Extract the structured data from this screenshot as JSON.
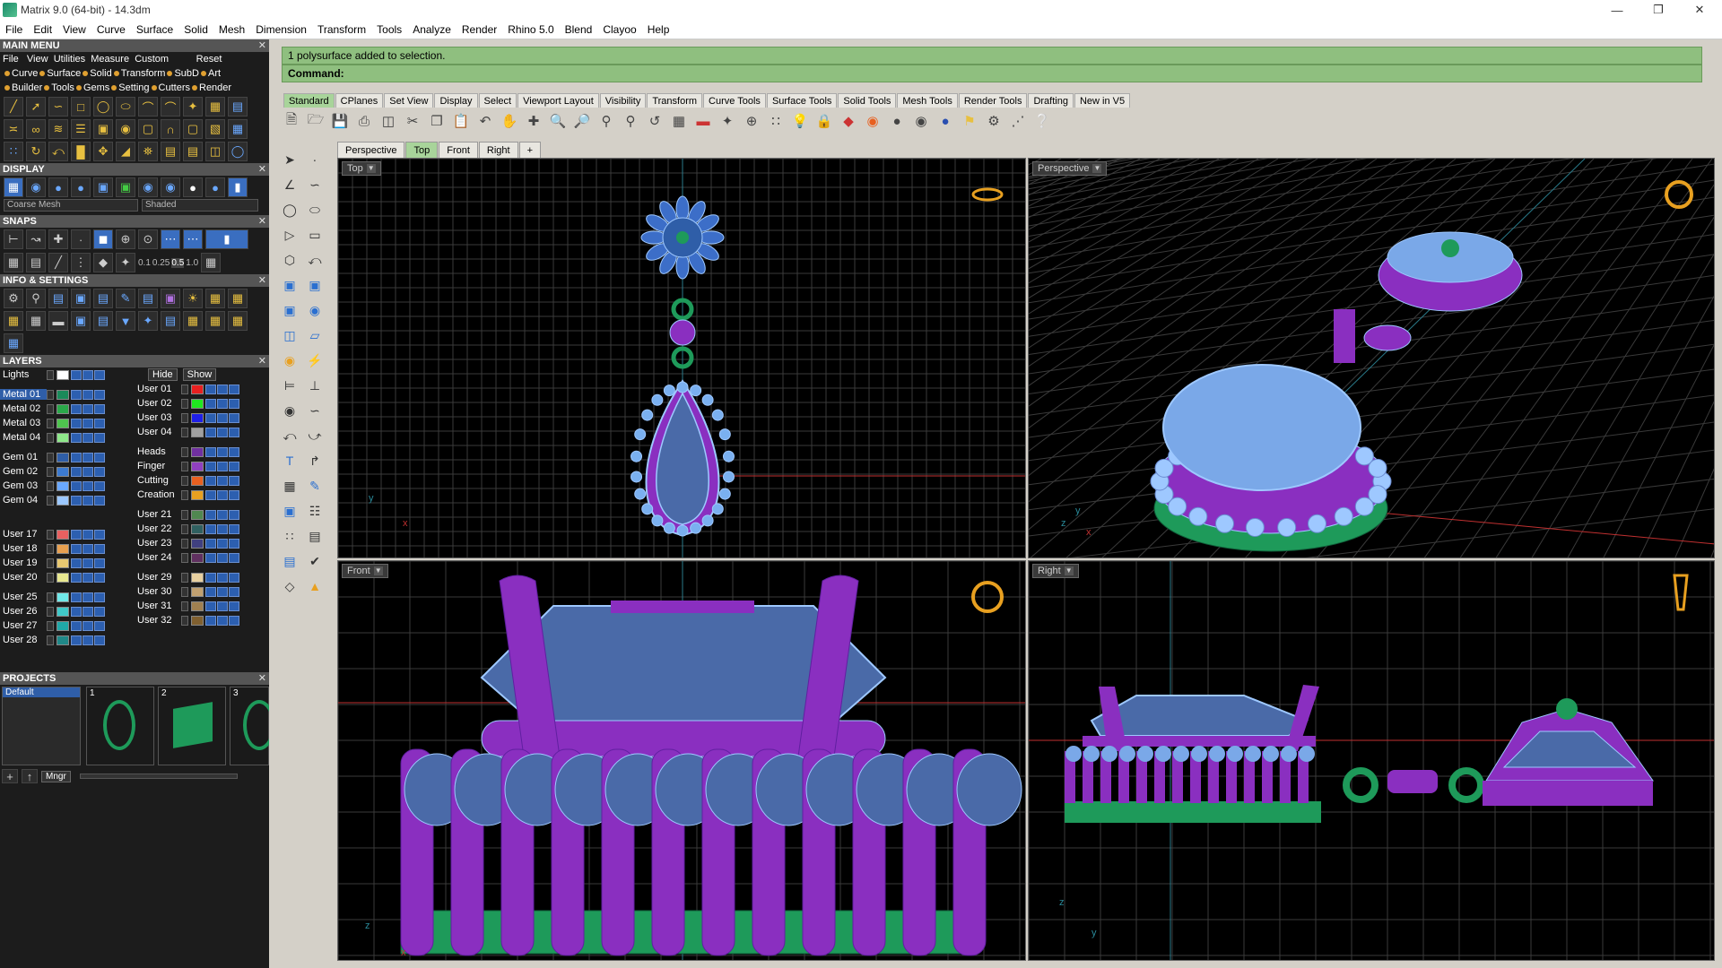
{
  "window": {
    "title": "Matrix 9.0 (64-bit) - 14.3dm",
    "minimize_icon": "minimize-icon",
    "maximize_icon": "maximize-icon",
    "close_icon": "close-icon"
  },
  "menubar": [
    "File",
    "Edit",
    "View",
    "Curve",
    "Surface",
    "Solid",
    "Mesh",
    "Dimension",
    "Transform",
    "Tools",
    "Analyze",
    "Render",
    "Rhino 5.0",
    "Blend",
    "Clayoo",
    "Help"
  ],
  "main_menu": {
    "title": "MAIN MENU",
    "reset": "Reset",
    "row1": [
      "File",
      "View",
      "Utilities",
      "Measure",
      "Custom"
    ],
    "row2": [
      "Curve",
      "Surface",
      "Solid",
      "Transform",
      "SubD",
      "Art"
    ],
    "row3": [
      "Builder",
      "Tools",
      "Gems",
      "Setting",
      "Cutters",
      "Render"
    ]
  },
  "display": {
    "title": "DISPLAY",
    "mesh_select": "Coarse Mesh",
    "shade_select": "Shaded"
  },
  "snaps": {
    "title": "SNAPS",
    "values": [
      "0.1",
      "0.25",
      "0.5",
      "1.0"
    ]
  },
  "info": {
    "title": "INFO & SETTINGS"
  },
  "layers": {
    "title": "LAYERS",
    "hide": "Hide",
    "show": "Show",
    "left": [
      {
        "name": "Lights",
        "color": "#ffffff"
      },
      {
        "name": "Metal 01",
        "color": "#1a8a5a",
        "selected": true
      },
      {
        "name": "Metal 02",
        "color": "#2aa84a"
      },
      {
        "name": "Metal 03",
        "color": "#4ec44e"
      },
      {
        "name": "Metal 04",
        "color": "#8ee88a"
      },
      {
        "name": "Gem 01",
        "color": "#2f5ea8"
      },
      {
        "name": "Gem 02",
        "color": "#3c7ad0"
      },
      {
        "name": "Gem 03",
        "color": "#6aa8ff"
      },
      {
        "name": "Gem 04",
        "color": "#9cc8ff"
      },
      {
        "name": "User 17",
        "color": "#e86060"
      },
      {
        "name": "User 18",
        "color": "#e8a050"
      },
      {
        "name": "User 19",
        "color": "#e8c870"
      },
      {
        "name": "User 20",
        "color": "#e8e890"
      },
      {
        "name": "User 25",
        "color": "#70e8e8"
      },
      {
        "name": "User 26",
        "color": "#40c8c8"
      },
      {
        "name": "User 27",
        "color": "#20a8a8"
      },
      {
        "name": "User 28",
        "color": "#208888"
      }
    ],
    "right": [
      {
        "name": "User 01",
        "color": "#e82020"
      },
      {
        "name": "User 02",
        "color": "#20e820"
      },
      {
        "name": "User 03",
        "color": "#2020e8"
      },
      {
        "name": "User 04",
        "color": "#a0a0a0"
      },
      {
        "name": "Heads",
        "color": "#7030a0"
      },
      {
        "name": "Finger",
        "color": "#9040c0"
      },
      {
        "name": "Cutting",
        "color": "#e86020"
      },
      {
        "name": "Creation",
        "color": "#e8a020"
      },
      {
        "name": "User 21",
        "color": "#508850"
      },
      {
        "name": "User 22",
        "color": "#306060"
      },
      {
        "name": "User 23",
        "color": "#404080"
      },
      {
        "name": "User 24",
        "color": "#603060"
      },
      {
        "name": "User 29",
        "color": "#e8d0a0"
      },
      {
        "name": "User 30",
        "color": "#c0a070"
      },
      {
        "name": "User 31",
        "color": "#a08050"
      },
      {
        "name": "User 32",
        "color": "#806030"
      }
    ]
  },
  "projects": {
    "title": "PROJECTS",
    "default": "Default",
    "items": [
      "1",
      "2",
      "3"
    ],
    "mngr": "Mngr"
  },
  "command": {
    "history": "1 polysurface added to selection.",
    "prompt": "Command:"
  },
  "toolbar_tabs": [
    "Standard",
    "CPlanes",
    "Set View",
    "Display",
    "Select",
    "Viewport Layout",
    "Visibility",
    "Transform",
    "Curve Tools",
    "Surface Tools",
    "Solid Tools",
    "Mesh Tools",
    "Render Tools",
    "Drafting",
    "New in V5"
  ],
  "viewport_tabs": [
    "Perspective",
    "Top",
    "Front",
    "Right"
  ],
  "viewports": {
    "top": "Top",
    "perspective": "Perspective",
    "front": "Front",
    "right": "Right"
  },
  "colors": {
    "metal": "#8a2fc0",
    "metal_green": "#1e9a5a",
    "gem": "#9ec8ff",
    "grid": "#3a3a3a",
    "axis_red": "#c03030"
  }
}
